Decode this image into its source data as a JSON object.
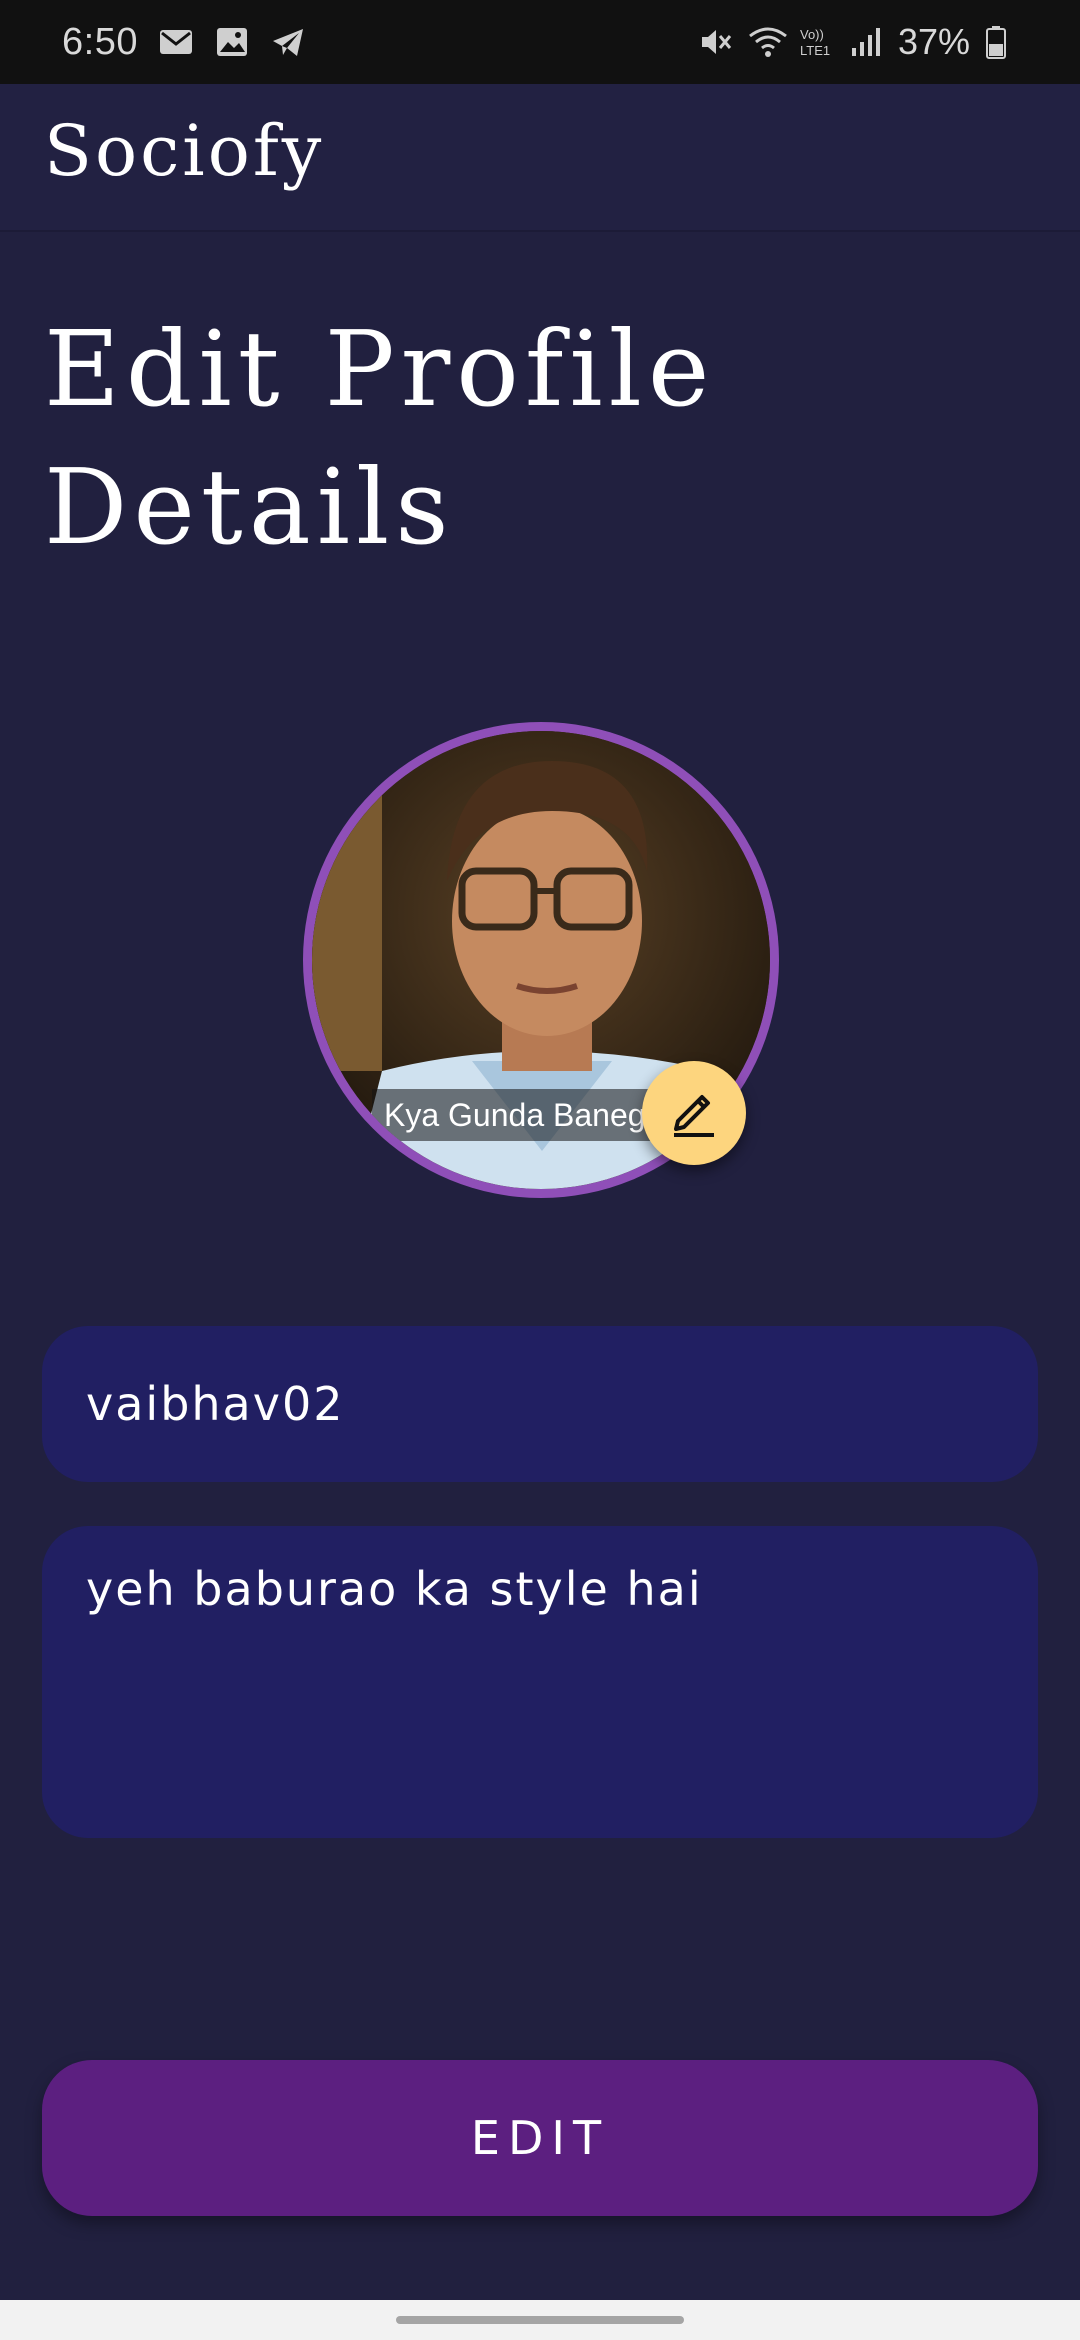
{
  "status_bar": {
    "time": "6:50",
    "battery": "37%",
    "left_icons": [
      "gmail-icon",
      "gallery-icon",
      "telegram-icon"
    ],
    "right_icons": [
      "mute-icon",
      "wifi-icon",
      "volte-icon",
      "signal-icon",
      "battery-icon"
    ]
  },
  "app": {
    "title": "Sociofy"
  },
  "page": {
    "heading": "Edit Profile Details"
  },
  "avatar": {
    "caption": "Kya Gunda Banega",
    "edit_icon": "pencil-icon",
    "accent_color": "#8f4fb8",
    "edit_button_color": "#fdd57e"
  },
  "form": {
    "username": "vaibhav02",
    "bio": "yeh baburao ka style hai"
  },
  "actions": {
    "edit_label": "EDIT",
    "button_color": "#5c1f80"
  },
  "colors": {
    "background": "#21203f",
    "field_background": "#211f62"
  }
}
